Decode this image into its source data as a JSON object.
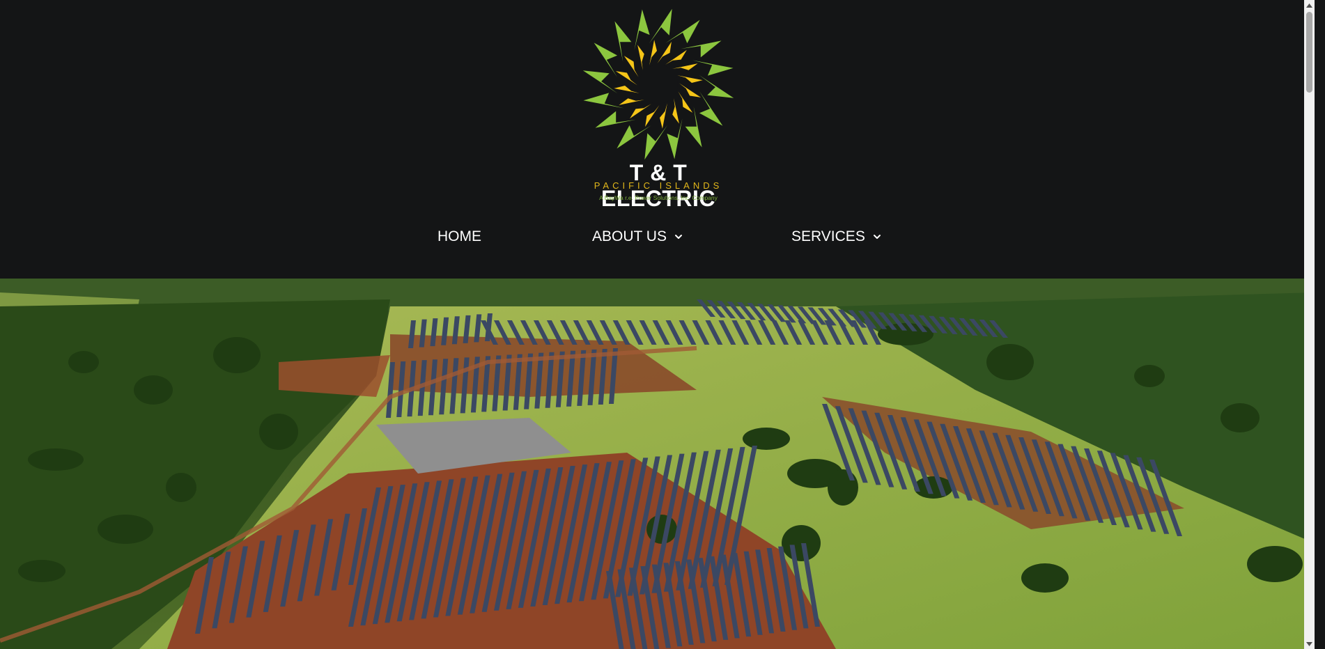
{
  "brand": {
    "title": "T & T ELECTRIC",
    "subtitle": "PACIFIC ISLANDS",
    "parent_company": "A BayWa r.e. Power Solutions, Inc. Company",
    "logo_icon": "sunburst-logo-icon",
    "colors": {
      "green": "#8cc63f",
      "yellow": "#f5c518",
      "background": "#141516"
    }
  },
  "nav": {
    "items": [
      {
        "label": "HOME",
        "has_dropdown": false
      },
      {
        "label": "ABOUT US",
        "has_dropdown": true
      },
      {
        "label": "SERVICES",
        "has_dropdown": true
      }
    ]
  },
  "hero": {
    "image": "aerial-solar-farm-photo"
  },
  "scrollbar": {
    "position": 0.0
  }
}
